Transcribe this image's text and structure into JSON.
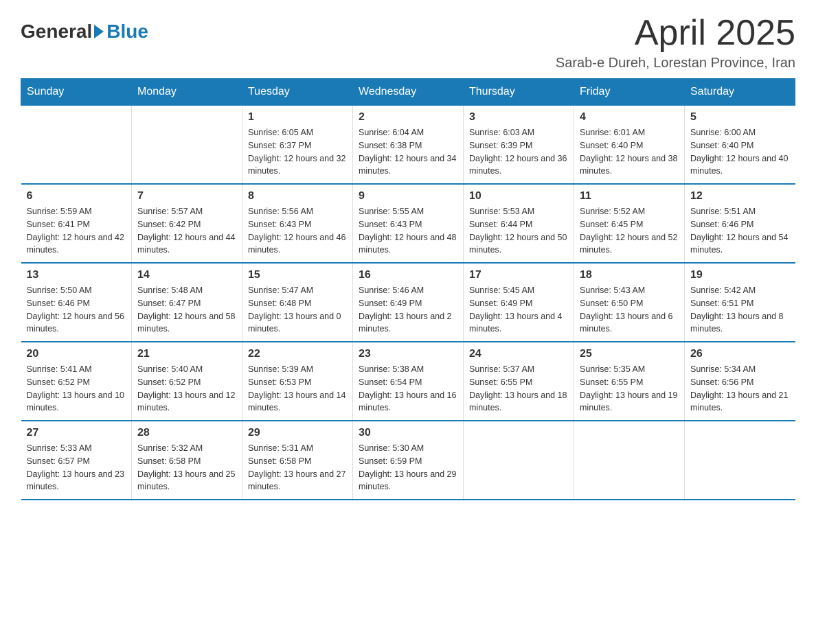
{
  "logo": {
    "general": "General",
    "blue": "Blue"
  },
  "title": {
    "month_year": "April 2025",
    "location": "Sarab-e Dureh, Lorestan Province, Iran"
  },
  "weekdays": [
    "Sunday",
    "Monday",
    "Tuesday",
    "Wednesday",
    "Thursday",
    "Friday",
    "Saturday"
  ],
  "weeks": [
    [
      {
        "day": "",
        "sunrise": "",
        "sunset": "",
        "daylight": ""
      },
      {
        "day": "",
        "sunrise": "",
        "sunset": "",
        "daylight": ""
      },
      {
        "day": "1",
        "sunrise": "Sunrise: 6:05 AM",
        "sunset": "Sunset: 6:37 PM",
        "daylight": "Daylight: 12 hours and 32 minutes."
      },
      {
        "day": "2",
        "sunrise": "Sunrise: 6:04 AM",
        "sunset": "Sunset: 6:38 PM",
        "daylight": "Daylight: 12 hours and 34 minutes."
      },
      {
        "day": "3",
        "sunrise": "Sunrise: 6:03 AM",
        "sunset": "Sunset: 6:39 PM",
        "daylight": "Daylight: 12 hours and 36 minutes."
      },
      {
        "day": "4",
        "sunrise": "Sunrise: 6:01 AM",
        "sunset": "Sunset: 6:40 PM",
        "daylight": "Daylight: 12 hours and 38 minutes."
      },
      {
        "day": "5",
        "sunrise": "Sunrise: 6:00 AM",
        "sunset": "Sunset: 6:40 PM",
        "daylight": "Daylight: 12 hours and 40 minutes."
      }
    ],
    [
      {
        "day": "6",
        "sunrise": "Sunrise: 5:59 AM",
        "sunset": "Sunset: 6:41 PM",
        "daylight": "Daylight: 12 hours and 42 minutes."
      },
      {
        "day": "7",
        "sunrise": "Sunrise: 5:57 AM",
        "sunset": "Sunset: 6:42 PM",
        "daylight": "Daylight: 12 hours and 44 minutes."
      },
      {
        "day": "8",
        "sunrise": "Sunrise: 5:56 AM",
        "sunset": "Sunset: 6:43 PM",
        "daylight": "Daylight: 12 hours and 46 minutes."
      },
      {
        "day": "9",
        "sunrise": "Sunrise: 5:55 AM",
        "sunset": "Sunset: 6:43 PM",
        "daylight": "Daylight: 12 hours and 48 minutes."
      },
      {
        "day": "10",
        "sunrise": "Sunrise: 5:53 AM",
        "sunset": "Sunset: 6:44 PM",
        "daylight": "Daylight: 12 hours and 50 minutes."
      },
      {
        "day": "11",
        "sunrise": "Sunrise: 5:52 AM",
        "sunset": "Sunset: 6:45 PM",
        "daylight": "Daylight: 12 hours and 52 minutes."
      },
      {
        "day": "12",
        "sunrise": "Sunrise: 5:51 AM",
        "sunset": "Sunset: 6:46 PM",
        "daylight": "Daylight: 12 hours and 54 minutes."
      }
    ],
    [
      {
        "day": "13",
        "sunrise": "Sunrise: 5:50 AM",
        "sunset": "Sunset: 6:46 PM",
        "daylight": "Daylight: 12 hours and 56 minutes."
      },
      {
        "day": "14",
        "sunrise": "Sunrise: 5:48 AM",
        "sunset": "Sunset: 6:47 PM",
        "daylight": "Daylight: 12 hours and 58 minutes."
      },
      {
        "day": "15",
        "sunrise": "Sunrise: 5:47 AM",
        "sunset": "Sunset: 6:48 PM",
        "daylight": "Daylight: 13 hours and 0 minutes."
      },
      {
        "day": "16",
        "sunrise": "Sunrise: 5:46 AM",
        "sunset": "Sunset: 6:49 PM",
        "daylight": "Daylight: 13 hours and 2 minutes."
      },
      {
        "day": "17",
        "sunrise": "Sunrise: 5:45 AM",
        "sunset": "Sunset: 6:49 PM",
        "daylight": "Daylight: 13 hours and 4 minutes."
      },
      {
        "day": "18",
        "sunrise": "Sunrise: 5:43 AM",
        "sunset": "Sunset: 6:50 PM",
        "daylight": "Daylight: 13 hours and 6 minutes."
      },
      {
        "day": "19",
        "sunrise": "Sunrise: 5:42 AM",
        "sunset": "Sunset: 6:51 PM",
        "daylight": "Daylight: 13 hours and 8 minutes."
      }
    ],
    [
      {
        "day": "20",
        "sunrise": "Sunrise: 5:41 AM",
        "sunset": "Sunset: 6:52 PM",
        "daylight": "Daylight: 13 hours and 10 minutes."
      },
      {
        "day": "21",
        "sunrise": "Sunrise: 5:40 AM",
        "sunset": "Sunset: 6:52 PM",
        "daylight": "Daylight: 13 hours and 12 minutes."
      },
      {
        "day": "22",
        "sunrise": "Sunrise: 5:39 AM",
        "sunset": "Sunset: 6:53 PM",
        "daylight": "Daylight: 13 hours and 14 minutes."
      },
      {
        "day": "23",
        "sunrise": "Sunrise: 5:38 AM",
        "sunset": "Sunset: 6:54 PM",
        "daylight": "Daylight: 13 hours and 16 minutes."
      },
      {
        "day": "24",
        "sunrise": "Sunrise: 5:37 AM",
        "sunset": "Sunset: 6:55 PM",
        "daylight": "Daylight: 13 hours and 18 minutes."
      },
      {
        "day": "25",
        "sunrise": "Sunrise: 5:35 AM",
        "sunset": "Sunset: 6:55 PM",
        "daylight": "Daylight: 13 hours and 19 minutes."
      },
      {
        "day": "26",
        "sunrise": "Sunrise: 5:34 AM",
        "sunset": "Sunset: 6:56 PM",
        "daylight": "Daylight: 13 hours and 21 minutes."
      }
    ],
    [
      {
        "day": "27",
        "sunrise": "Sunrise: 5:33 AM",
        "sunset": "Sunset: 6:57 PM",
        "daylight": "Daylight: 13 hours and 23 minutes."
      },
      {
        "day": "28",
        "sunrise": "Sunrise: 5:32 AM",
        "sunset": "Sunset: 6:58 PM",
        "daylight": "Daylight: 13 hours and 25 minutes."
      },
      {
        "day": "29",
        "sunrise": "Sunrise: 5:31 AM",
        "sunset": "Sunset: 6:58 PM",
        "daylight": "Daylight: 13 hours and 27 minutes."
      },
      {
        "day": "30",
        "sunrise": "Sunrise: 5:30 AM",
        "sunset": "Sunset: 6:59 PM",
        "daylight": "Daylight: 13 hours and 29 minutes."
      },
      {
        "day": "",
        "sunrise": "",
        "sunset": "",
        "daylight": ""
      },
      {
        "day": "",
        "sunrise": "",
        "sunset": "",
        "daylight": ""
      },
      {
        "day": "",
        "sunrise": "",
        "sunset": "",
        "daylight": ""
      }
    ]
  ]
}
